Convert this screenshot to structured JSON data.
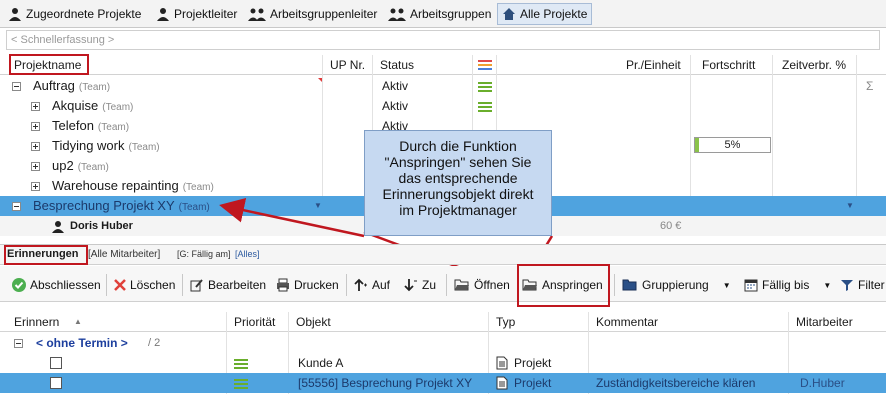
{
  "tabs": [
    {
      "label": "Zugeordnete Projekte"
    },
    {
      "label": "Projektleiter"
    },
    {
      "label": "Arbeitsgruppenleiter"
    },
    {
      "label": "Arbeitsgruppen"
    },
    {
      "label": "Alle Projekte"
    }
  ],
  "quick_entry": {
    "placeholder": "< Schnellerfassung >"
  },
  "columns": {
    "name": "Projektname",
    "up": "UP Nr.",
    "status": "Status",
    "price": "Pr./Einheit",
    "progress": "Fortschritt",
    "time": "Zeitverbr. %",
    "sum_symbol": "Σ"
  },
  "team_tag": "(Team)",
  "projects": [
    {
      "name": "Auftrag",
      "status": "Aktiv"
    },
    {
      "name": "Akquise",
      "status": "Aktiv"
    },
    {
      "name": "Telefon",
      "status": "Aktiv"
    },
    {
      "name": "Tidying work",
      "progress_label": "5%",
      "progress_value": 0.05
    },
    {
      "name": "up2"
    },
    {
      "name": "Warehouse repainting"
    },
    {
      "name": "Besprechung Projekt XY"
    },
    {
      "name": "Doris Huber",
      "price": "60 €"
    }
  ],
  "callout": {
    "lines": [
      "Durch die Funktion",
      "\"Anspringen\" sehen Sie",
      "das entsprechende",
      "Erinnerungsobjekt direkt",
      "im Projektmanager"
    ]
  },
  "reminders_header": {
    "title": "Erinnerungen",
    "filter1": "[Alle Mitarbeiter]",
    "filter2": "[G: Fällig am]",
    "filter3": "[Alles]"
  },
  "toolbar": {
    "close": "Abschliessen",
    "delete": "Löschen",
    "edit": "Bearbeiten",
    "print": "Drucken",
    "up": "Auf",
    "down": "Zu",
    "open": "Öffnen",
    "jump": "Anspringen",
    "group": "Gruppierung",
    "due": "Fällig bis",
    "filter": "Filter"
  },
  "lower_columns": {
    "remind": "Erinnern",
    "priority": "Priorität",
    "object": "Objekt",
    "type": "Typ",
    "comment": "Kommentar",
    "employee": "Mitarbeiter"
  },
  "group": {
    "label": "< ohne Termin >",
    "count": "/ 2"
  },
  "reminders": [
    {
      "object": "Kunde A",
      "type": "Projekt",
      "comment": "",
      "employee": ""
    },
    {
      "object": "[55556] Besprechung Projekt XY",
      "type": "Projekt",
      "comment": "Zuständigkeitsbereiche klären",
      "employee": "D.Huber"
    }
  ],
  "colors": {
    "accent": "#4fa3df",
    "highlight": "#c0171f",
    "priority": "#6aae2c",
    "callout": "#c6d9f1"
  }
}
